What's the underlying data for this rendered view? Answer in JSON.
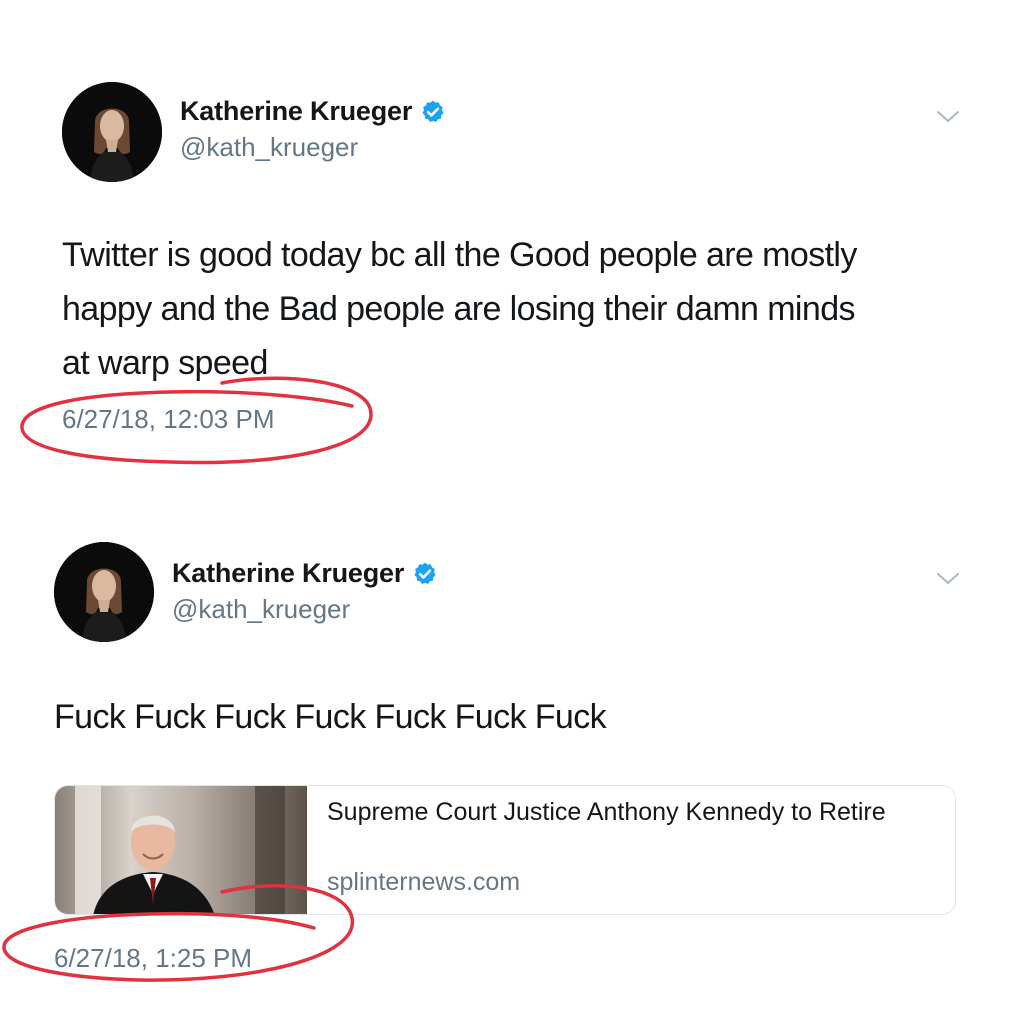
{
  "tweets": [
    {
      "author_name": "Katherine Krueger",
      "author_handle": "@kath_krueger",
      "text_lines": [
        "Twitter is good today bc all the Good people are mostly",
        "happy and the Bad people are losing their damn minds",
        "at warp speed"
      ],
      "timestamp": "6/27/18, 12:03 PM"
    },
    {
      "author_name": "Katherine Krueger",
      "author_handle": "@kath_krueger",
      "text_lines": [
        "Fuck Fuck Fuck Fuck Fuck Fuck Fuck"
      ],
      "link_card": {
        "title": "Supreme Court Justice Anthony Kennedy to Retire",
        "domain": "splinternews.com"
      },
      "timestamp": "6/27/18, 1:25 PM"
    }
  ],
  "icons": {
    "verified": "verified-badge-icon",
    "menu": "chevron-down-icon"
  },
  "colors": {
    "verified_blue": "#1da1f2",
    "annotation_red": "#e0323f",
    "muted_text": "#657786"
  }
}
